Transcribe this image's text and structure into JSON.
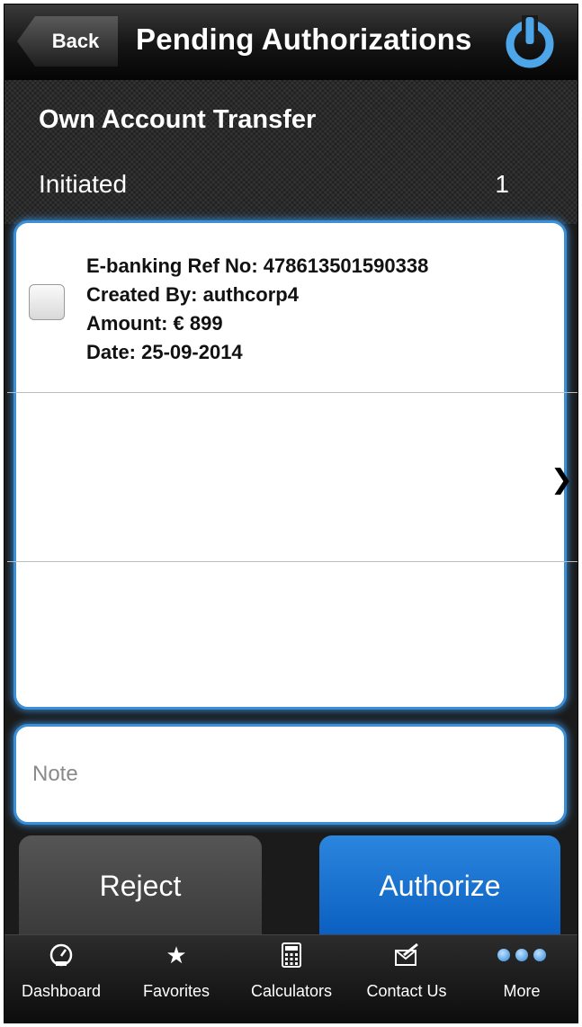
{
  "header": {
    "back_label": "Back",
    "title": "Pending Authorizations",
    "power_icon": "power-icon"
  },
  "section": {
    "title": "Own Account Transfer",
    "status_label": "Initiated",
    "status_count": "1"
  },
  "list": {
    "items": [
      {
        "ref": "E-banking Ref No: 478613501590338",
        "created_by": "Created By: authcorp4",
        "amount": "Amount: € 899",
        "date": "Date: 25-09-2014"
      }
    ]
  },
  "note": {
    "placeholder": "Note",
    "value": ""
  },
  "actions": {
    "reject_label": "Reject",
    "authorize_label": "Authorize"
  },
  "tabs": [
    {
      "label": "Dashboard",
      "icon": "dashboard-gauge-icon"
    },
    {
      "label": "Favorites",
      "icon": "star-icon"
    },
    {
      "label": "Calculators",
      "icon": "calculator-icon"
    },
    {
      "label": "Contact Us",
      "icon": "contact-mail-icon"
    },
    {
      "label": "More",
      "icon": "more-dots-icon"
    }
  ],
  "colors": {
    "accent": "#3b8fd6",
    "authorize": "#0a5fc0",
    "reject": "#3a3a3a"
  }
}
